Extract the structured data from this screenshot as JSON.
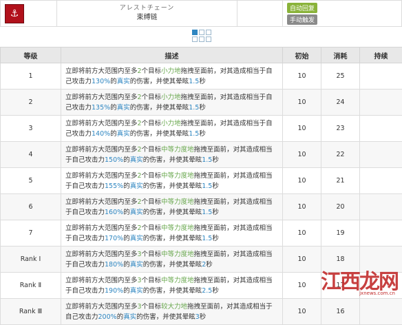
{
  "skill": {
    "icon_name": "chain-skill-icon",
    "jp_name": "アレストチェーン",
    "cn_name": "束缚链",
    "tags": [
      "自动回复",
      "手动触发"
    ]
  },
  "table": {
    "headers": [
      "等级",
      "描述",
      "初始",
      "消耗",
      "持续"
    ],
    "rows": [
      {
        "level": "1",
        "d1": "立即将前方大范围内至多",
        "n": "2",
        "d2": "个目标",
        "force": "小力地",
        "d3": "拖拽至面前，对其造成相当于自己攻击力",
        "pct": "130%",
        "d4": "的",
        "dmg": "真实",
        "d5": "的伤害，并使其晕眩",
        "stun": "1.5",
        "d6": "秒",
        "init": "10",
        "cost": "25",
        "dur": ""
      },
      {
        "level": "2",
        "d1": "立即将前方大范围内至多",
        "n": "2",
        "d2": "个目标",
        "force": "小力地",
        "d3": "拖拽至面前，对其造成相当于自己攻击力",
        "pct": "135%",
        "d4": "的",
        "dmg": "真实",
        "d5": "的伤害，并使其晕眩",
        "stun": "1.5",
        "d6": "秒",
        "init": "10",
        "cost": "24",
        "dur": ""
      },
      {
        "level": "3",
        "d1": "立即将前方大范围内至多",
        "n": "2",
        "d2": "个目标",
        "force": "小力地",
        "d3": "拖拽至面前，对其造成相当于自己攻击力",
        "pct": "140%",
        "d4": "的",
        "dmg": "真实",
        "d5": "的伤害，并使其晕眩",
        "stun": "1.5",
        "d6": "秒",
        "init": "10",
        "cost": "23",
        "dur": ""
      },
      {
        "level": "4",
        "d1": "立即将前方大范围内至多",
        "n": "2",
        "d2": "个目标",
        "force": "中等力度地",
        "d3": "拖拽至面前，对其造成相当于自己攻击力",
        "pct": "150%",
        "d4": "的",
        "dmg": "真实",
        "d5": "的伤害，并使其晕眩",
        "stun": "1.5",
        "d6": "秒",
        "init": "10",
        "cost": "22",
        "dur": ""
      },
      {
        "level": "5",
        "d1": "立即将前方大范围内至多",
        "n": "2",
        "d2": "个目标",
        "force": "中等力度地",
        "d3": "拖拽至面前，对其造成相当于自己攻击力",
        "pct": "155%",
        "d4": "的",
        "dmg": "真实",
        "d5": "的伤害，并使其晕眩",
        "stun": "1.5",
        "d6": "秒",
        "init": "10",
        "cost": "21",
        "dur": ""
      },
      {
        "level": "6",
        "d1": "立即将前方大范围内至多",
        "n": "2",
        "d2": "个目标",
        "force": "中等力度地",
        "d3": "拖拽至面前，对其造成相当于自己攻击力",
        "pct": "160%",
        "d4": "的",
        "dmg": "真实",
        "d5": "的伤害，并使其晕眩",
        "stun": "1.5",
        "d6": "秒",
        "init": "10",
        "cost": "20",
        "dur": ""
      },
      {
        "level": "7",
        "d1": "立即将前方大范围内至多",
        "n": "2",
        "d2": "个目标",
        "force": "中等力度地",
        "d3": "拖拽至面前，对其造成相当于自己攻击力",
        "pct": "170%",
        "d4": "的",
        "dmg": "真实",
        "d5": "的伤害，并使其晕眩",
        "stun": "1.5",
        "d6": "秒",
        "init": "10",
        "cost": "19",
        "dur": ""
      },
      {
        "level": "Rank Ⅰ",
        "d1": "立即将前方大范围内至多",
        "n": "3",
        "d2": "个目标",
        "force": "中等力度地",
        "d3": "拖拽至面前，对其造成相当于自己攻击力",
        "pct": "180%",
        "d4": "的",
        "dmg": "真实",
        "d5": "的伤害，并使其晕眩",
        "stun": "2",
        "d6": "秒",
        "init": "10",
        "cost": "18",
        "dur": ""
      },
      {
        "level": "Rank Ⅱ",
        "d1": "立即将前方大范围内至多",
        "n": "3",
        "d2": "个目标",
        "force": "中等力度地",
        "d3": "拖拽至面前，对其造成相当于自己攻击力",
        "pct": "190%",
        "d4": "的",
        "dmg": "真实",
        "d5": "的伤害，并使其晕眩",
        "stun": "2.5",
        "d6": "秒",
        "init": "10",
        "cost": "17",
        "dur": ""
      },
      {
        "level": "Rank Ⅲ",
        "d1": "立即将前方大范围内至多",
        "n": "3",
        "d2": "个目标",
        "force": "较大力地",
        "d3": "拖拽至面前，对其造成相当于自己攻击力",
        "pct": "200%",
        "d4": "的",
        "dmg": "真实",
        "d5": "的伤害，并使其晕眩",
        "stun": "3",
        "d6": "秒",
        "init": "10",
        "cost": "16",
        "dur": ""
      }
    ]
  },
  "watermark": {
    "main": "江西龙网",
    "sub": "jxnews.com.cn"
  },
  "colors": {
    "green": "#6aa84f",
    "blue": "#2e86c1",
    "header_bg": "#e8e8e8"
  }
}
